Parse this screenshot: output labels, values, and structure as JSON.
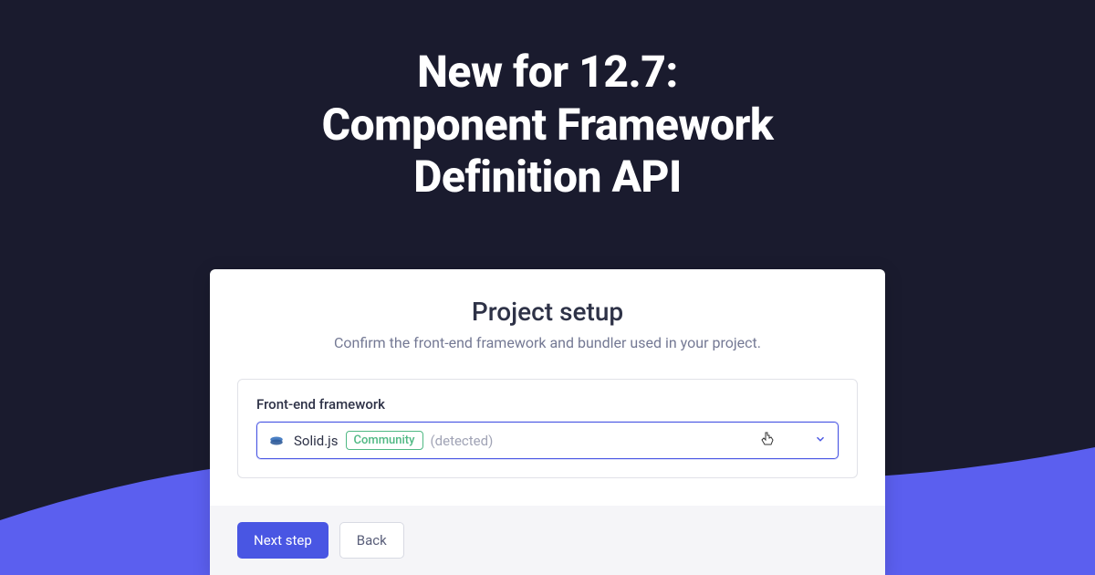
{
  "hero": {
    "line1": "New for 12.7:",
    "line2": "Component Framework",
    "line3": "Definition API"
  },
  "card": {
    "title": "Project setup",
    "subtitle": "Confirm the front-end framework and bundler used in your project."
  },
  "field": {
    "label": "Front-end framework",
    "selected_name": "Solid.js",
    "badge": "Community",
    "detected_text": "(detected)"
  },
  "buttons": {
    "next": "Next step",
    "back": "Back"
  },
  "colors": {
    "accent": "#4956e3",
    "wave": "#5b5fef"
  }
}
